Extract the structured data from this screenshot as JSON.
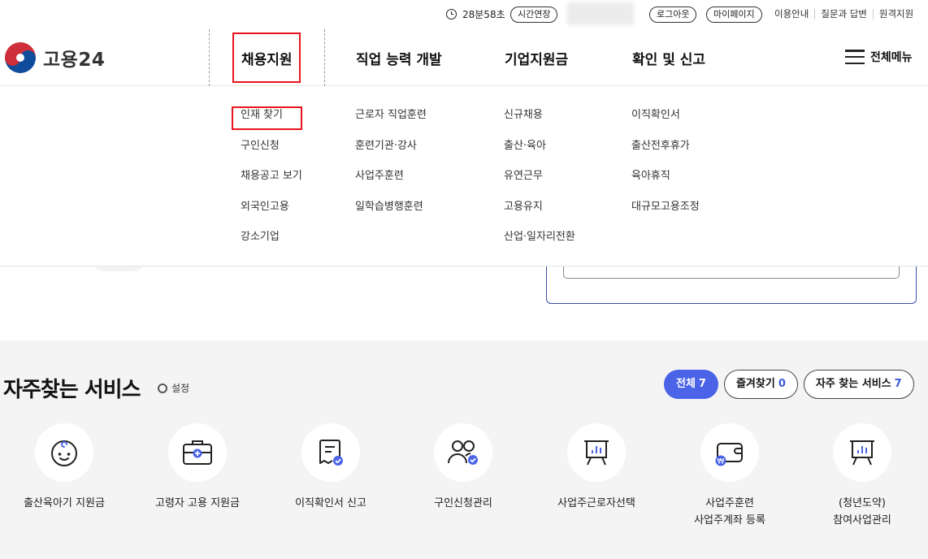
{
  "topbar": {
    "timer": "28분58초",
    "extend_label": "시간연장",
    "logout_label": "로그아웃",
    "mypage_label": "마이페이지",
    "links": [
      "이용안내",
      "질문과 답변",
      "원격지원"
    ]
  },
  "header": {
    "logo_text": "고용24",
    "gnb": [
      {
        "label": "채용지원"
      },
      {
        "label": "직업 능력 개발"
      },
      {
        "label": "기업지원금"
      },
      {
        "label": "확인 및 신고"
      }
    ],
    "all_menu_label": "전체메뉴"
  },
  "dropdown": {
    "columns": [
      {
        "items": [
          "인재 찾기",
          "구인신청",
          "채용공고 보기",
          "외국인고용",
          "강소기업"
        ]
      },
      {
        "items": [
          "근로자 직업훈련",
          "훈련기관·강사",
          "사업주훈련",
          "일학습병행훈련"
        ]
      },
      {
        "items": [
          "신규채용",
          "출산·육아",
          "유연근무",
          "고용유지",
          "산업·일자리전환"
        ]
      },
      {
        "items": [
          "이직확인서",
          "출산전후휴가",
          "육아휴직",
          "대규모고용조정"
        ]
      }
    ]
  },
  "services": {
    "title": "자주찾는 서비스",
    "setting_label": "설정",
    "tabs": [
      {
        "label": "전체",
        "count": "7"
      },
      {
        "label": "즐겨찾기",
        "count": "0"
      },
      {
        "label": "자주 찾는 서비스",
        "count": "7"
      }
    ],
    "items": [
      {
        "label": "출산육아기 지원금",
        "icon": "baby-face-icon"
      },
      {
        "label": "고령자 고용 지원금",
        "icon": "briefcase-plus-icon"
      },
      {
        "label": "이직확인서 신고",
        "icon": "document-check-icon"
      },
      {
        "label": "구인신청관리",
        "icon": "users-check-icon"
      },
      {
        "label": "사업주근로자선택",
        "icon": "presentation-board-icon"
      },
      {
        "label": "사업주훈련\n사업주계좌 등록",
        "label_lines": [
          "사업주훈련",
          "사업주계좌 등록"
        ],
        "icon": "wallet-won-icon"
      },
      {
        "label_lines": [
          "(청년도약)",
          "참여사업관리"
        ],
        "icon": "presentation-board-icon"
      }
    ],
    "accent_color": "#4a63e7"
  }
}
